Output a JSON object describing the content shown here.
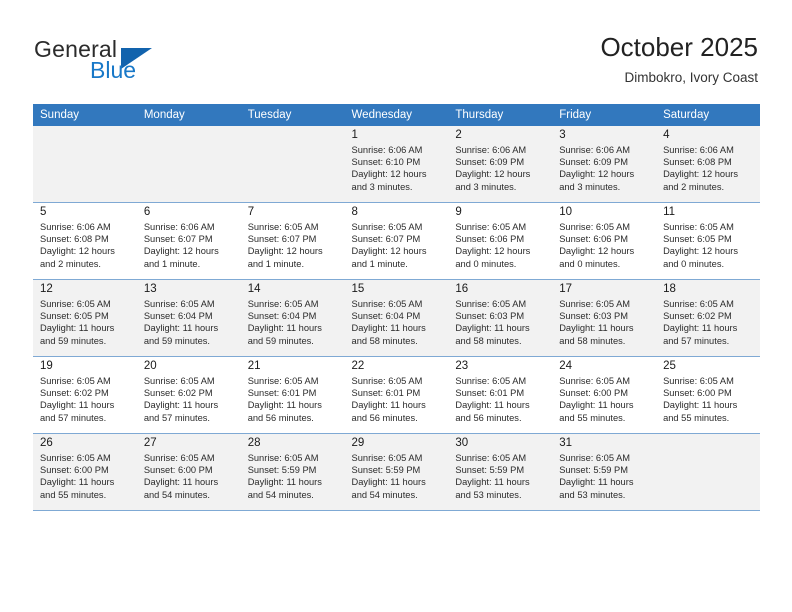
{
  "brand": {
    "word_one": "General",
    "word_two": "Blue",
    "logo_icon": "blue-triangle-icon"
  },
  "header": {
    "title": "October 2025",
    "subtitle": "Dimbokro, Ivory Coast"
  },
  "colors": {
    "header_blue": "#3278be",
    "brand_blue": "#1878c8",
    "logo_blue": "#1263ad",
    "row_shade": "#f2f2f2",
    "row_border": "#7fa9d4"
  },
  "calendar": {
    "weekday_headers": [
      "Sunday",
      "Monday",
      "Tuesday",
      "Wednesday",
      "Thursday",
      "Friday",
      "Saturday"
    ],
    "weeks": [
      {
        "shaded": true,
        "days": [
          {
            "empty": true
          },
          {
            "empty": true
          },
          {
            "empty": true
          },
          {
            "day": "1",
            "sunrise": "Sunrise: 6:06 AM",
            "sunset": "Sunset: 6:10 PM",
            "daylight_line1": "Daylight: 12 hours",
            "daylight_line2": "and 3 minutes."
          },
          {
            "day": "2",
            "sunrise": "Sunrise: 6:06 AM",
            "sunset": "Sunset: 6:09 PM",
            "daylight_line1": "Daylight: 12 hours",
            "daylight_line2": "and 3 minutes."
          },
          {
            "day": "3",
            "sunrise": "Sunrise: 6:06 AM",
            "sunset": "Sunset: 6:09 PM",
            "daylight_line1": "Daylight: 12 hours",
            "daylight_line2": "and 3 minutes."
          },
          {
            "day": "4",
            "sunrise": "Sunrise: 6:06 AM",
            "sunset": "Sunset: 6:08 PM",
            "daylight_line1": "Daylight: 12 hours",
            "daylight_line2": "and 2 minutes."
          }
        ]
      },
      {
        "shaded": false,
        "days": [
          {
            "day": "5",
            "sunrise": "Sunrise: 6:06 AM",
            "sunset": "Sunset: 6:08 PM",
            "daylight_line1": "Daylight: 12 hours",
            "daylight_line2": "and 2 minutes."
          },
          {
            "day": "6",
            "sunrise": "Sunrise: 6:06 AM",
            "sunset": "Sunset: 6:07 PM",
            "daylight_line1": "Daylight: 12 hours",
            "daylight_line2": "and 1 minute."
          },
          {
            "day": "7",
            "sunrise": "Sunrise: 6:05 AM",
            "sunset": "Sunset: 6:07 PM",
            "daylight_line1": "Daylight: 12 hours",
            "daylight_line2": "and 1 minute."
          },
          {
            "day": "8",
            "sunrise": "Sunrise: 6:05 AM",
            "sunset": "Sunset: 6:07 PM",
            "daylight_line1": "Daylight: 12 hours",
            "daylight_line2": "and 1 minute."
          },
          {
            "day": "9",
            "sunrise": "Sunrise: 6:05 AM",
            "sunset": "Sunset: 6:06 PM",
            "daylight_line1": "Daylight: 12 hours",
            "daylight_line2": "and 0 minutes."
          },
          {
            "day": "10",
            "sunrise": "Sunrise: 6:05 AM",
            "sunset": "Sunset: 6:06 PM",
            "daylight_line1": "Daylight: 12 hours",
            "daylight_line2": "and 0 minutes."
          },
          {
            "day": "11",
            "sunrise": "Sunrise: 6:05 AM",
            "sunset": "Sunset: 6:05 PM",
            "daylight_line1": "Daylight: 12 hours",
            "daylight_line2": "and 0 minutes."
          }
        ]
      },
      {
        "shaded": true,
        "days": [
          {
            "day": "12",
            "sunrise": "Sunrise: 6:05 AM",
            "sunset": "Sunset: 6:05 PM",
            "daylight_line1": "Daylight: 11 hours",
            "daylight_line2": "and 59 minutes."
          },
          {
            "day": "13",
            "sunrise": "Sunrise: 6:05 AM",
            "sunset": "Sunset: 6:04 PM",
            "daylight_line1": "Daylight: 11 hours",
            "daylight_line2": "and 59 minutes."
          },
          {
            "day": "14",
            "sunrise": "Sunrise: 6:05 AM",
            "sunset": "Sunset: 6:04 PM",
            "daylight_line1": "Daylight: 11 hours",
            "daylight_line2": "and 59 minutes."
          },
          {
            "day": "15",
            "sunrise": "Sunrise: 6:05 AM",
            "sunset": "Sunset: 6:04 PM",
            "daylight_line1": "Daylight: 11 hours",
            "daylight_line2": "and 58 minutes."
          },
          {
            "day": "16",
            "sunrise": "Sunrise: 6:05 AM",
            "sunset": "Sunset: 6:03 PM",
            "daylight_line1": "Daylight: 11 hours",
            "daylight_line2": "and 58 minutes."
          },
          {
            "day": "17",
            "sunrise": "Sunrise: 6:05 AM",
            "sunset": "Sunset: 6:03 PM",
            "daylight_line1": "Daylight: 11 hours",
            "daylight_line2": "and 58 minutes."
          },
          {
            "day": "18",
            "sunrise": "Sunrise: 6:05 AM",
            "sunset": "Sunset: 6:02 PM",
            "daylight_line1": "Daylight: 11 hours",
            "daylight_line2": "and 57 minutes."
          }
        ]
      },
      {
        "shaded": false,
        "days": [
          {
            "day": "19",
            "sunrise": "Sunrise: 6:05 AM",
            "sunset": "Sunset: 6:02 PM",
            "daylight_line1": "Daylight: 11 hours",
            "daylight_line2": "and 57 minutes."
          },
          {
            "day": "20",
            "sunrise": "Sunrise: 6:05 AM",
            "sunset": "Sunset: 6:02 PM",
            "daylight_line1": "Daylight: 11 hours",
            "daylight_line2": "and 57 minutes."
          },
          {
            "day": "21",
            "sunrise": "Sunrise: 6:05 AM",
            "sunset": "Sunset: 6:01 PM",
            "daylight_line1": "Daylight: 11 hours",
            "daylight_line2": "and 56 minutes."
          },
          {
            "day": "22",
            "sunrise": "Sunrise: 6:05 AM",
            "sunset": "Sunset: 6:01 PM",
            "daylight_line1": "Daylight: 11 hours",
            "daylight_line2": "and 56 minutes."
          },
          {
            "day": "23",
            "sunrise": "Sunrise: 6:05 AM",
            "sunset": "Sunset: 6:01 PM",
            "daylight_line1": "Daylight: 11 hours",
            "daylight_line2": "and 56 minutes."
          },
          {
            "day": "24",
            "sunrise": "Sunrise: 6:05 AM",
            "sunset": "Sunset: 6:00 PM",
            "daylight_line1": "Daylight: 11 hours",
            "daylight_line2": "and 55 minutes."
          },
          {
            "day": "25",
            "sunrise": "Sunrise: 6:05 AM",
            "sunset": "Sunset: 6:00 PM",
            "daylight_line1": "Daylight: 11 hours",
            "daylight_line2": "and 55 minutes."
          }
        ]
      },
      {
        "shaded": true,
        "days": [
          {
            "day": "26",
            "sunrise": "Sunrise: 6:05 AM",
            "sunset": "Sunset: 6:00 PM",
            "daylight_line1": "Daylight: 11 hours",
            "daylight_line2": "and 55 minutes."
          },
          {
            "day": "27",
            "sunrise": "Sunrise: 6:05 AM",
            "sunset": "Sunset: 6:00 PM",
            "daylight_line1": "Daylight: 11 hours",
            "daylight_line2": "and 54 minutes."
          },
          {
            "day": "28",
            "sunrise": "Sunrise: 6:05 AM",
            "sunset": "Sunset: 5:59 PM",
            "daylight_line1": "Daylight: 11 hours",
            "daylight_line2": "and 54 minutes."
          },
          {
            "day": "29",
            "sunrise": "Sunrise: 6:05 AM",
            "sunset": "Sunset: 5:59 PM",
            "daylight_line1": "Daylight: 11 hours",
            "daylight_line2": "and 54 minutes."
          },
          {
            "day": "30",
            "sunrise": "Sunrise: 6:05 AM",
            "sunset": "Sunset: 5:59 PM",
            "daylight_line1": "Daylight: 11 hours",
            "daylight_line2": "and 53 minutes."
          },
          {
            "day": "31",
            "sunrise": "Sunrise: 6:05 AM",
            "sunset": "Sunset: 5:59 PM",
            "daylight_line1": "Daylight: 11 hours",
            "daylight_line2": "and 53 minutes."
          },
          {
            "empty": true
          }
        ]
      }
    ]
  }
}
